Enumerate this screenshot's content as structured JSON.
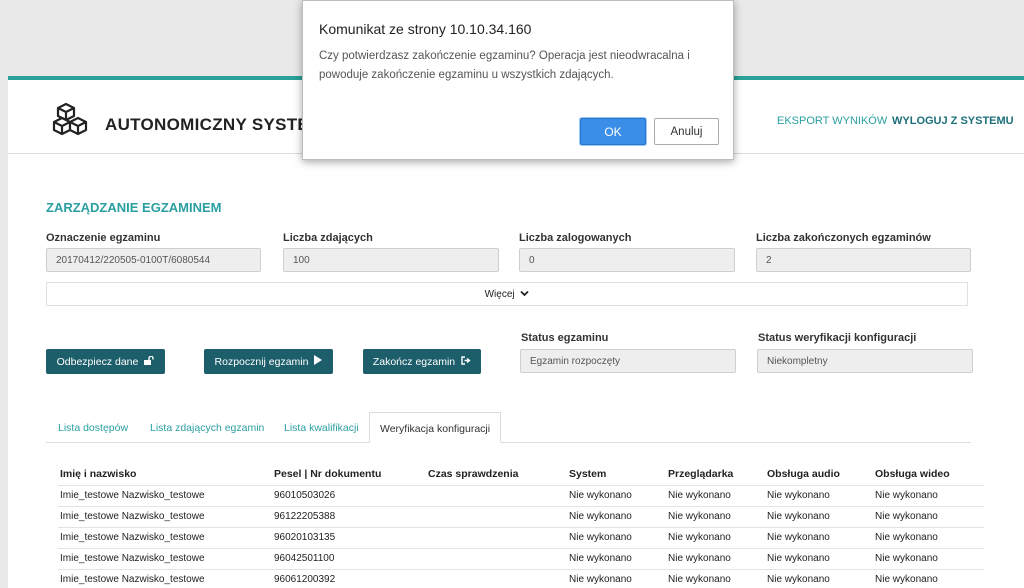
{
  "header": {
    "app_title": "AUTONOMICZNY SYSTE",
    "nav": {
      "export": "EKSPORT WYNIKÓW",
      "logout": "WYLOGUJ Z SYSTEMU"
    }
  },
  "exam": {
    "section_title": "ZARZĄDZANIE EGZAMINEM",
    "fields": [
      {
        "label": "Oznaczenie egzaminu",
        "value": "20170412/220505-0100T/6080544"
      },
      {
        "label": "Liczba zdających",
        "value": "100"
      },
      {
        "label": "Liczba zalogowanych",
        "value": "0"
      },
      {
        "label": "Liczba zakończonych egzaminów",
        "value": "2"
      }
    ],
    "more_label": "Więcej"
  },
  "actions": {
    "unlock": "Odbezpiecz dane",
    "start": "Rozpocznij egzamin",
    "finish": "Zakończ egzamin"
  },
  "status": {
    "exam_label": "Status egzaminu",
    "exam_value": "Egzamin rozpoczęty",
    "config_label": "Status weryfikacji konfiguracji",
    "config_value": "Niekompletny"
  },
  "tabs": [
    "Lista dostępów",
    "Lista zdających egzamin",
    "Lista kwalifikacji",
    "Weryfikacja konfiguracji"
  ],
  "table": {
    "columns": [
      "Imię i nazwisko",
      "Pesel | Nr dokumentu",
      "Czas sprawdzenia",
      "System",
      "Przeglądarka",
      "Obsługa audio",
      "Obsługa wideo"
    ],
    "rows": [
      [
        "Imie_testowe Nazwisko_testowe",
        "96010503026",
        "",
        "Nie wykonano",
        "Nie wykonano",
        "Nie wykonano",
        "Nie wykonano"
      ],
      [
        "Imie_testowe Nazwisko_testowe",
        "96122205388",
        "",
        "Nie wykonano",
        "Nie wykonano",
        "Nie wykonano",
        "Nie wykonano"
      ],
      [
        "Imie_testowe Nazwisko_testowe",
        "96020103135",
        "",
        "Nie wykonano",
        "Nie wykonano",
        "Nie wykonano",
        "Nie wykonano"
      ],
      [
        "Imie_testowe Nazwisko_testowe",
        "96042501100",
        "",
        "Nie wykonano",
        "Nie wykonano",
        "Nie wykonano",
        "Nie wykonano"
      ],
      [
        "Imie_testowe Nazwisko_testowe",
        "96061200392",
        "",
        "Nie wykonano",
        "Nie wykonano",
        "Nie wykonano",
        "Nie wykonano"
      ]
    ]
  },
  "dialog": {
    "title": "Komunikat ze strony 10.10.34.160",
    "message": "Czy potwierdzasz zakończenie egzaminu? Operacja jest nieodwracalna i powoduje zakończenie egzaminu u wszystkich zdających.",
    "ok": "OK",
    "cancel": "Anuluj"
  },
  "colors": {
    "accent": "#2aa198",
    "button": "#1d5e6b",
    "dialog_ok": "#3b8ee8"
  }
}
